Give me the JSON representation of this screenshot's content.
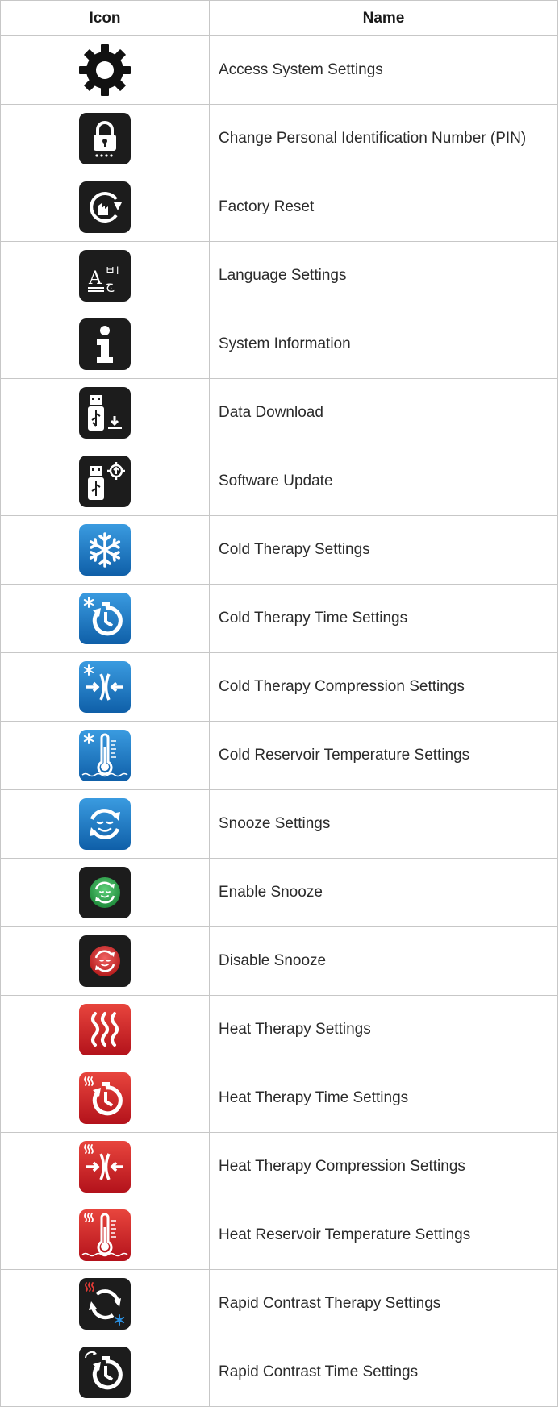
{
  "table": {
    "headers": {
      "icon": "Icon",
      "name": "Name"
    },
    "rows": [
      {
        "name": "Access System Settings",
        "icon": "gear-icon",
        "color": "#111111"
      },
      {
        "name": "Change Personal Identification Number (PIN)",
        "icon": "lock-icon",
        "color": "#1c1c1c"
      },
      {
        "name": "Factory Reset",
        "icon": "factory-reset-icon",
        "color": "#1c1c1c"
      },
      {
        "name": "Language Settings",
        "icon": "language-icon",
        "color": "#1c1c1c"
      },
      {
        "name": "System Information",
        "icon": "info-icon",
        "color": "#1c1c1c"
      },
      {
        "name": "Data Download",
        "icon": "usb-download-icon",
        "color": "#1c1c1c"
      },
      {
        "name": "Software Update",
        "icon": "usb-update-icon",
        "color": "#1c1c1c"
      },
      {
        "name": "Cold Therapy Settings",
        "icon": "snowflake-icon",
        "color": "#1b7fc8"
      },
      {
        "name": "Cold Therapy Time Settings",
        "icon": "cold-timer-icon",
        "color": "#1b7fc8"
      },
      {
        "name": "Cold Therapy Compression Settings",
        "icon": "cold-compression-icon",
        "color": "#1b7fc8"
      },
      {
        "name": "Cold Reservoir Temperature Settings",
        "icon": "cold-thermometer-icon",
        "color": "#1b7fc8"
      },
      {
        "name": "Snooze Settings",
        "icon": "snooze-icon",
        "color": "#1b7fc8"
      },
      {
        "name": "Enable Snooze",
        "icon": "snooze-enable-icon",
        "color": "#2fa84f"
      },
      {
        "name": "Disable Snooze",
        "icon": "snooze-disable-icon",
        "color": "#d62b2b"
      },
      {
        "name": "Heat Therapy Settings",
        "icon": "heat-waves-icon",
        "color": "#d0202a"
      },
      {
        "name": "Heat Therapy Time Settings",
        "icon": "heat-timer-icon",
        "color": "#d0202a"
      },
      {
        "name": "Heat Therapy Compression Settings",
        "icon": "heat-compression-icon",
        "color": "#d0202a"
      },
      {
        "name": "Heat Reservoir Temperature Settings",
        "icon": "heat-thermometer-icon",
        "color": "#d0202a"
      },
      {
        "name": "Rapid Contrast Therapy Settings",
        "icon": "rapid-contrast-icon",
        "color": "#1c1c1c"
      },
      {
        "name": "Rapid Contrast Time Settings",
        "icon": "rapid-contrast-timer-icon",
        "color": "#1c1c1c"
      }
    ]
  }
}
